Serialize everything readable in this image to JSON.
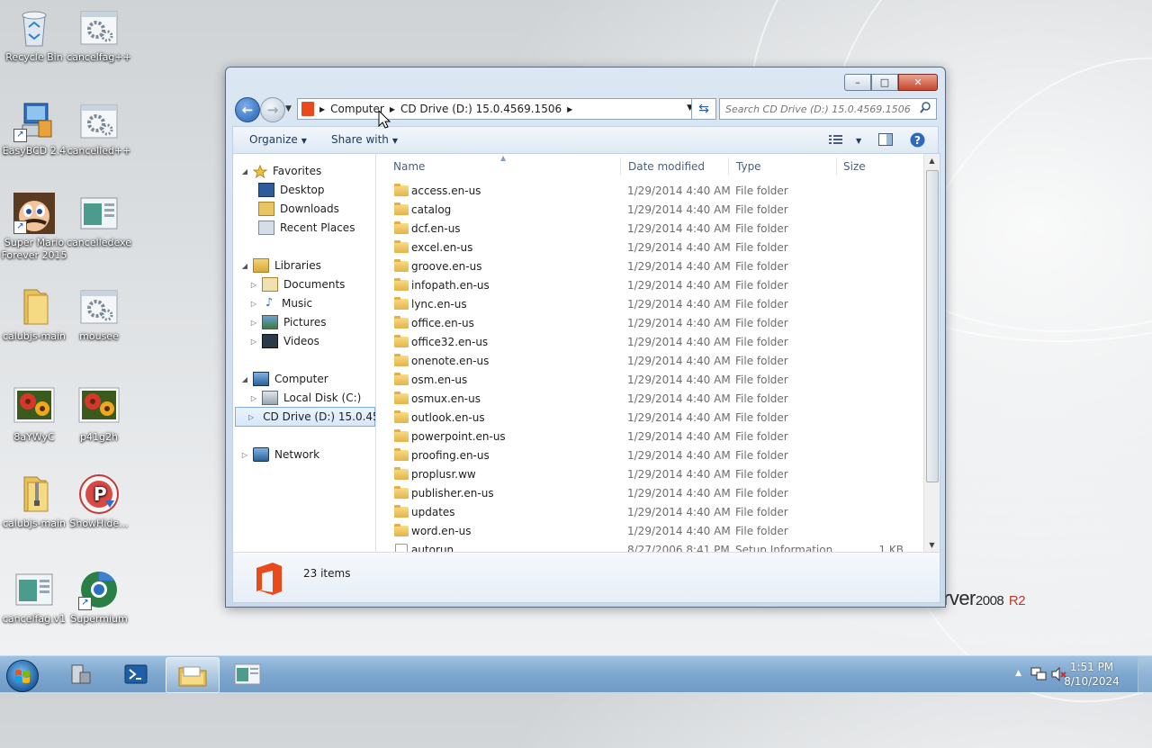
{
  "desktop": {
    "icons": [
      {
        "label": "Recycle Bin",
        "icon": "recycle-bin-icon"
      },
      {
        "label": "cancelfag++",
        "icon": "settings-app-icon"
      },
      {
        "label": "EasyBCD 2.4",
        "icon": "easybcd-icon"
      },
      {
        "label": "cancelled++",
        "icon": "settings-app-icon"
      },
      {
        "label": "Super Mario Forever 2015",
        "icon": "mario-icon"
      },
      {
        "label": "cancelledexe",
        "icon": "window-app-icon"
      },
      {
        "label": "calubjs-main",
        "icon": "folder-icon"
      },
      {
        "label": "mousee",
        "icon": "settings-app-icon"
      },
      {
        "label": "8aYWyC",
        "icon": "flower-image-icon"
      },
      {
        "label": "p41g2h",
        "icon": "flower-image-icon"
      },
      {
        "label": "calubjs-main",
        "icon": "zip-folder-icon"
      },
      {
        "label": "ShowHide...",
        "icon": "showhide-icon"
      },
      {
        "label": "cancelfag.v1",
        "icon": "window-app-icon"
      },
      {
        "label": "Supermium",
        "icon": "supermium-browser-icon"
      }
    ],
    "brand": {
      "text": "rver",
      "version": "2008",
      "edition": "R2"
    }
  },
  "window": {
    "caption_buttons": {
      "minimize": "–",
      "maximize": "□",
      "close": "✕"
    },
    "address": {
      "crumbs": [
        "Computer",
        "CD Drive (D:) 15.0.4569.1506"
      ]
    },
    "search": {
      "placeholder": "Search CD Drive (D:) 15.0.4569.1506"
    },
    "toolbar": {
      "organize": "Organize",
      "share_with": "Share with"
    },
    "nav": {
      "favorites": "Favorites",
      "desktop": "Desktop",
      "downloads": "Downloads",
      "recent_places": "Recent Places",
      "libraries": "Libraries",
      "documents": "Documents",
      "music": "Music",
      "pictures": "Pictures",
      "videos": "Videos",
      "computer": "Computer",
      "local_disk": "Local Disk (C:)",
      "cd_drive": "CD Drive (D:) 15.0.45",
      "network": "Network"
    },
    "columns": {
      "name": "Name",
      "date": "Date modified",
      "type": "Type",
      "size": "Size"
    },
    "files": [
      {
        "name": "access.en-us",
        "date": "1/29/2014 4:40 AM",
        "type": "File folder",
        "size": ""
      },
      {
        "name": "catalog",
        "date": "1/29/2014 4:40 AM",
        "type": "File folder",
        "size": ""
      },
      {
        "name": "dcf.en-us",
        "date": "1/29/2014 4:40 AM",
        "type": "File folder",
        "size": ""
      },
      {
        "name": "excel.en-us",
        "date": "1/29/2014 4:40 AM",
        "type": "File folder",
        "size": ""
      },
      {
        "name": "groove.en-us",
        "date": "1/29/2014 4:40 AM",
        "type": "File folder",
        "size": ""
      },
      {
        "name": "infopath.en-us",
        "date": "1/29/2014 4:40 AM",
        "type": "File folder",
        "size": ""
      },
      {
        "name": "lync.en-us",
        "date": "1/29/2014 4:40 AM",
        "type": "File folder",
        "size": ""
      },
      {
        "name": "office.en-us",
        "date": "1/29/2014 4:40 AM",
        "type": "File folder",
        "size": ""
      },
      {
        "name": "office32.en-us",
        "date": "1/29/2014 4:40 AM",
        "type": "File folder",
        "size": ""
      },
      {
        "name": "onenote.en-us",
        "date": "1/29/2014 4:40 AM",
        "type": "File folder",
        "size": ""
      },
      {
        "name": "osm.en-us",
        "date": "1/29/2014 4:40 AM",
        "type": "File folder",
        "size": ""
      },
      {
        "name": "osmux.en-us",
        "date": "1/29/2014 4:40 AM",
        "type": "File folder",
        "size": ""
      },
      {
        "name": "outlook.en-us",
        "date": "1/29/2014 4:40 AM",
        "type": "File folder",
        "size": ""
      },
      {
        "name": "powerpoint.en-us",
        "date": "1/29/2014 4:40 AM",
        "type": "File folder",
        "size": ""
      },
      {
        "name": "proofing.en-us",
        "date": "1/29/2014 4:40 AM",
        "type": "File folder",
        "size": ""
      },
      {
        "name": "proplusr.ww",
        "date": "1/29/2014 4:40 AM",
        "type": "File folder",
        "size": ""
      },
      {
        "name": "publisher.en-us",
        "date": "1/29/2014 4:40 AM",
        "type": "File folder",
        "size": ""
      },
      {
        "name": "updates",
        "date": "1/29/2014 4:40 AM",
        "type": "File folder",
        "size": ""
      },
      {
        "name": "word.en-us",
        "date": "1/29/2014 4:40 AM",
        "type": "File folder",
        "size": ""
      },
      {
        "name": "autorun",
        "date": "8/27/2006 8:41 PM",
        "type": "Setup Information",
        "size": "1 KB"
      }
    ],
    "details": {
      "count": "23 items"
    }
  },
  "taskbar": {
    "clock_time": "1:51 PM",
    "clock_date": "8/10/2024"
  },
  "colors": {
    "accent": "#1f5fb2",
    "office_red": "#e84a1c"
  }
}
